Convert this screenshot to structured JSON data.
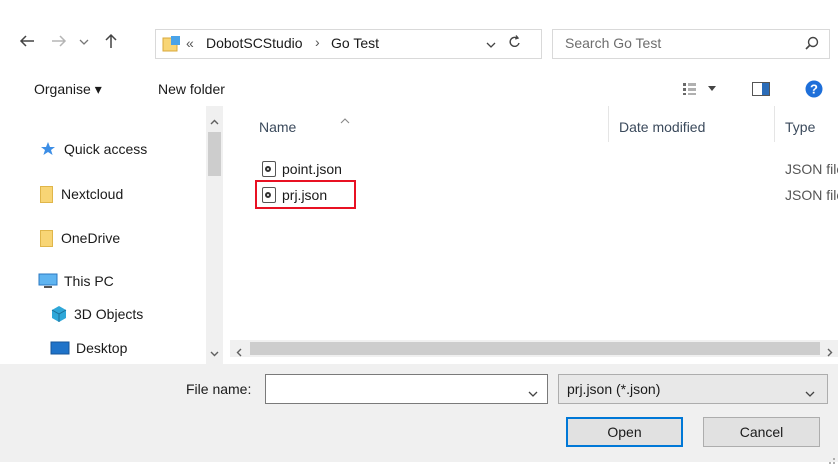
{
  "address": {
    "overflow": "«",
    "segment1": "DobotSCStudio",
    "separator": "›",
    "segment2": "Go Test"
  },
  "search": {
    "placeholder": "Search Go Test"
  },
  "toolbar": {
    "organise_label": "Organise ▾",
    "new_folder_label": "New folder"
  },
  "sidebar": {
    "items": [
      {
        "label": "Quick access",
        "icon": "star-icon"
      },
      {
        "label": "Nextcloud",
        "icon": "folder-icon"
      },
      {
        "label": "OneDrive",
        "icon": "folder-icon"
      },
      {
        "label": "This PC",
        "icon": "computer-icon"
      },
      {
        "label": "3D Objects",
        "icon": "cube-icon"
      },
      {
        "label": "Desktop",
        "icon": "desktop-icon"
      }
    ]
  },
  "columns": {
    "name": "Name",
    "date_modified": "Date modified",
    "type": "Type"
  },
  "files": [
    {
      "name": "point.json",
      "type": "JSON file",
      "highlighted": false
    },
    {
      "name": "prj.json",
      "type": "JSON file",
      "highlighted": true
    }
  ],
  "footer": {
    "file_name_label": "File name:",
    "file_name_value": "",
    "filter_value": "prj.json (*.json)",
    "open_label": "Open",
    "cancel_label": "Cancel"
  },
  "colors": {
    "highlight_box": "#e81123",
    "accent_blue": "#0078d7",
    "help_icon": "#1e6fd9"
  }
}
